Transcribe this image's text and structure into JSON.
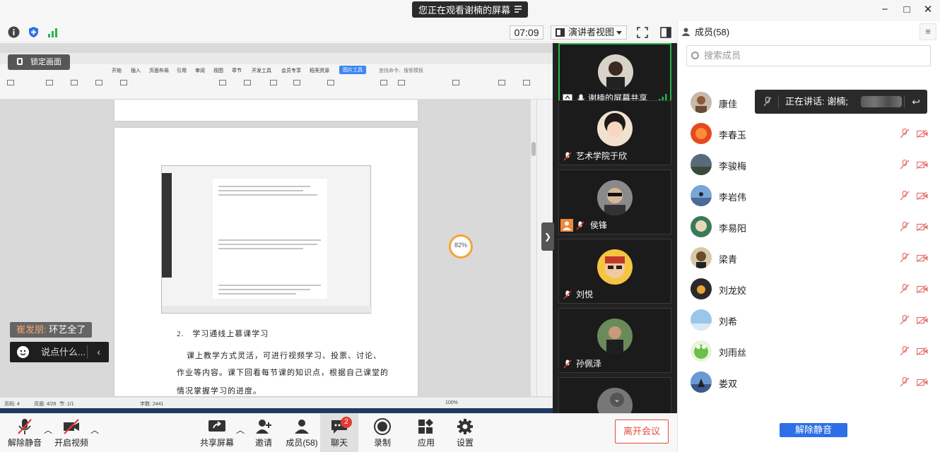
{
  "titlebar": {
    "share_banner": "您正在观看谢楠的屏幕",
    "minimize": "−",
    "maximize": "□",
    "close": "✕"
  },
  "toolbar": {
    "timer": "07:09",
    "view_mode": "演讲者视图"
  },
  "shared_screen": {
    "lock_label": "锁定画面",
    "progress_ring": "82%",
    "doc_heading": "2.　学习通线上慕课学习",
    "doc_line1": "课上教学方式灵活，可进行视频学习、投票、讨论、",
    "doc_line2": "作业等内容。课下回看每节课的知识点，根据自己课堂的",
    "doc_line3": "情况掌握学习的进度。",
    "ribbon_tabs": [
      "开始",
      "插入",
      "页面布局",
      "引用",
      "审阅",
      "视图",
      "章节",
      "开发工具",
      "会员专享",
      "稻壳资源"
    ],
    "ribbon_active_tab": "图片工具",
    "ribbon_search": "查找命令、搜索模板",
    "status_page": "页码: 4",
    "status_pages": "页面: 4/26",
    "status_section": "节: 1/1",
    "status_words": "字数: 2441",
    "status_zoom": "100%"
  },
  "chat": {
    "last_sender": "崔发朋:",
    "last_message": "环艺全了",
    "input_placeholder": "说点什么...",
    "collapse_icon": "‹"
  },
  "video_tiles": [
    {
      "name": "谢楠的屏幕共享",
      "active": true
    },
    {
      "name": "艺术学院于欣",
      "active": false
    },
    {
      "name": "侯锋",
      "active": false
    },
    {
      "name": "刘悦",
      "active": false
    },
    {
      "name": "孙佩泽",
      "active": false
    }
  ],
  "members": {
    "title": "成员(58)",
    "search_placeholder": "搜索成员",
    "speaking_label": "正在讲话: 谢楠;",
    "list": [
      {
        "name": "康佳"
      },
      {
        "name": "李春玉"
      },
      {
        "name": "李骏梅"
      },
      {
        "name": "李岩伟"
      },
      {
        "name": "李易阳"
      },
      {
        "name": "梁青"
      },
      {
        "name": "刘龙姣"
      },
      {
        "name": "刘希"
      },
      {
        "name": "刘雨丝"
      },
      {
        "name": "娄双"
      }
    ],
    "unmute_all": "解除静音"
  },
  "bottombar": {
    "unmute": "解除静音",
    "start_video": "开启视频",
    "share_screen": "共享屏幕",
    "invite": "邀请",
    "members": "成员(58)",
    "chat": "聊天",
    "chat_badge": "2",
    "record": "录制",
    "apps": "应用",
    "settings": "设置",
    "leave": "离开会议"
  },
  "colors": {
    "accent": "#2d6fe6",
    "active_tile": "#2bb34a",
    "danger": "#e74c3c"
  }
}
